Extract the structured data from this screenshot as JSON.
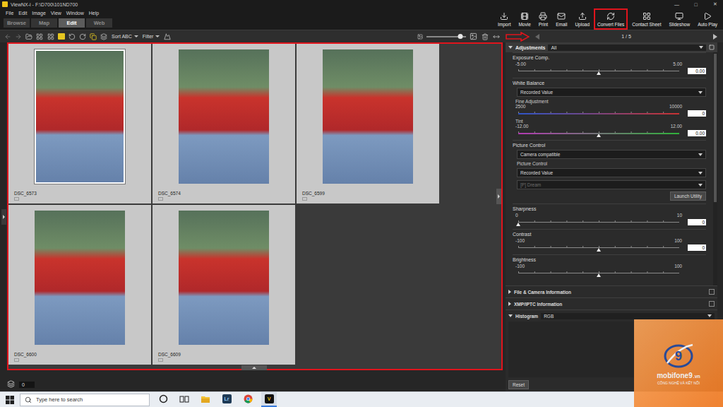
{
  "window": {
    "title": "ViewNX-i - F:\\D700\\101ND700",
    "controls": [
      "—",
      "□",
      "✕"
    ]
  },
  "menu": [
    "File",
    "Edit",
    "Image",
    "View",
    "Window",
    "Help"
  ],
  "modes": [
    {
      "label": "Browse",
      "selected": false
    },
    {
      "label": "Map",
      "selected": false
    },
    {
      "label": "Edit",
      "selected": true
    },
    {
      "label": "Web",
      "selected": false
    }
  ],
  "toolbar": [
    {
      "label": "Import",
      "highlighted": false
    },
    {
      "label": "Movie",
      "highlighted": false
    },
    {
      "label": "Print",
      "highlighted": false
    },
    {
      "label": "Email",
      "highlighted": false
    },
    {
      "label": "Upload",
      "highlighted": false
    },
    {
      "label": "Convert Files",
      "highlighted": true
    },
    {
      "label": "Contact Sheet",
      "highlighted": false
    },
    {
      "label": "Slideshow",
      "highlighted": false
    },
    {
      "label": "Auto Play",
      "highlighted": false
    }
  ],
  "browser_bar": {
    "sort": "Sort ABC",
    "filter": "Filter",
    "zoom_level": 0.85
  },
  "grid": {
    "highlighted": true,
    "thumbnails": [
      {
        "name": "DSC_6573",
        "selected": true
      },
      {
        "name": "DSC_6574",
        "selected": false
      },
      {
        "name": "DSC_6599",
        "selected": false
      },
      {
        "name": "DSC_6600",
        "selected": false
      },
      {
        "name": "DSC_6609",
        "selected": false
      }
    ]
  },
  "status": {
    "count": "0"
  },
  "viewer_nav": {
    "position": "1 / 5",
    "annotated": true
  },
  "adjustments": {
    "title": "Adjustments",
    "preset": "All",
    "groups": [
      {
        "title": "Exposure Comp.",
        "rows": [
          {
            "kind": "slider",
            "min": "-5.00",
            "max": "5.00",
            "value": "0.00",
            "level": 0.5,
            "marker": true
          }
        ]
      },
      {
        "title": "White Balance",
        "rows": [
          {
            "kind": "dropdown",
            "value": "Recorded Value",
            "disabled": false
          },
          {
            "kind": "slider",
            "label": "Fine Adjustment",
            "min": "2500",
            "max": "10000",
            "value": "0",
            "marker": false,
            "gradient": [
              "#2f55c8",
              "#c83232"
            ]
          },
          {
            "kind": "slider",
            "label": "Tint",
            "min": "-12.00",
            "max": "12.00",
            "value": "0.00",
            "level": 0.5,
            "marker": true,
            "gradient": [
              "#b23ab2",
              "#2fb23a"
            ]
          }
        ]
      },
      {
        "title": "Picture Control",
        "rows": [
          {
            "kind": "dropdown",
            "value": "Camera compatible",
            "disabled": false
          },
          {
            "kind": "label",
            "label": "Picture Control"
          },
          {
            "kind": "dropdown",
            "value": "Recorded Value",
            "disabled": false
          },
          {
            "kind": "dropdown",
            "value": "[P] Dream",
            "disabled": true
          },
          {
            "kind": "button",
            "label": "Launch Utility"
          }
        ]
      },
      {
        "title": "Sharpness",
        "rows": [
          {
            "kind": "slider",
            "min": "0",
            "max": "10",
            "value": "0",
            "level": 0,
            "marker": true
          }
        ]
      },
      {
        "title": "Contrast",
        "rows": [
          {
            "kind": "slider",
            "min": "-100",
            "max": "100",
            "value": "0",
            "level": 0.5,
            "marker": true
          }
        ]
      },
      {
        "title": "Brightness",
        "rows": [
          {
            "kind": "slider",
            "min": "-100",
            "max": "100",
            "level": 0.5,
            "marker": true
          }
        ]
      }
    ]
  },
  "sections": [
    {
      "label": "File & Camera Information",
      "expanded": false
    },
    {
      "label": "XMP/IPTC Information",
      "expanded": false
    },
    {
      "label": "Histogram",
      "option": "RGB",
      "expanded": true
    }
  ],
  "reset": "Reset",
  "taskbar": {
    "search_placeholder": "Type here to search",
    "apps": [
      {
        "kind": "cortana",
        "active": false
      },
      {
        "kind": "taskview",
        "active": false
      },
      {
        "kind": "explorer",
        "active": false
      },
      {
        "kind": "lightroom",
        "text": "Lr",
        "active": false
      },
      {
        "kind": "chrome",
        "active": false
      },
      {
        "kind": "viewnx",
        "text": "V",
        "active": true
      }
    ]
  },
  "watermark": {
    "brand": "mobifone9",
    "domain": ".vn",
    "tagline": "CÔNG NGHỆ VÀ KẾT NỐI",
    "mark": "9"
  }
}
